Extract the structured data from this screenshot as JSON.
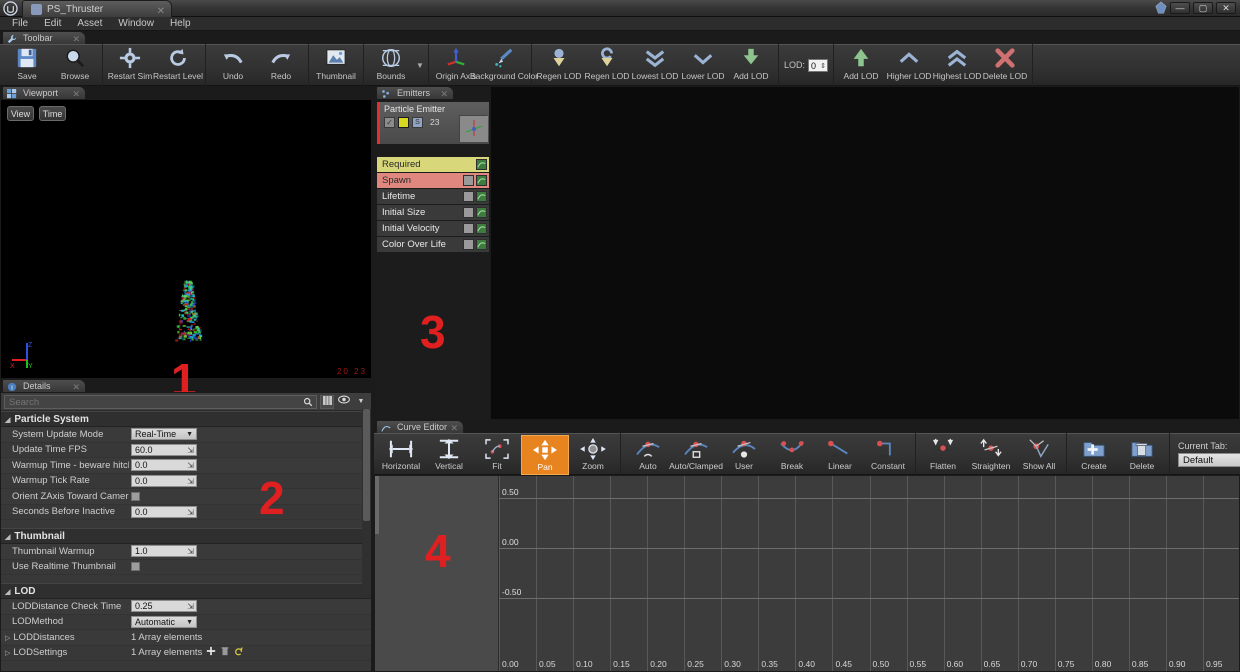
{
  "window": {
    "tab_title": "PS_Thruster",
    "logo_icon": "unreal-logo-icon",
    "minimize_label": "—",
    "maximize_label": "▢",
    "close_label": "✕"
  },
  "menu": {
    "items": [
      "File",
      "Edit",
      "Asset",
      "Window",
      "Help"
    ]
  },
  "toolbar": {
    "tab_label": "Toolbar",
    "groups": [
      {
        "buttons": [
          {
            "label": "Save",
            "icon": "save-disk-icon"
          },
          {
            "label": "Browse",
            "icon": "magnifier-icon"
          }
        ]
      },
      {
        "buttons": [
          {
            "label": "Restart Sim",
            "icon": "gear-icon"
          },
          {
            "label": "Restart Level",
            "icon": "refresh-circle-icon"
          }
        ]
      },
      {
        "buttons": [
          {
            "label": "Undo",
            "icon": "undo-arrow-icon"
          },
          {
            "label": "Redo",
            "icon": "redo-arrow-icon"
          }
        ]
      },
      {
        "buttons": [
          {
            "label": "Thumbnail",
            "icon": "thumbnail-icon"
          }
        ]
      },
      {
        "buttons": [
          {
            "label": "Bounds",
            "icon": "bounds-sphere-icon"
          }
        ],
        "has_caret": true
      },
      {
        "buttons": [
          {
            "label": "Origin Axis",
            "icon": "origin-axis-icon"
          },
          {
            "label": "Background Color",
            "icon": "paint-brush-icon"
          }
        ]
      },
      {
        "buttons": [
          {
            "label": "Regen LOD",
            "icon": "regen-lod-down-icon"
          },
          {
            "label": "Regen LOD",
            "icon": "regen-lod-dup-icon"
          },
          {
            "label": "Lowest LOD",
            "icon": "double-chevron-down-icon"
          },
          {
            "label": "Lower LOD",
            "icon": "chevron-down-icon"
          },
          {
            "label": "Add LOD",
            "icon": "plus-down-icon"
          }
        ]
      },
      {
        "buttons": [
          {
            "label": "Add LOD",
            "icon": "plus-up-icon"
          },
          {
            "label": "Higher LOD",
            "icon": "chevron-up-icon"
          },
          {
            "label": "Highest LOD",
            "icon": "double-chevron-up-icon"
          },
          {
            "label": "Delete LOD",
            "icon": "delete-x-icon"
          }
        ]
      }
    ],
    "lod_label": "LOD:",
    "lod_value": "0"
  },
  "viewport": {
    "tab_label": "Viewport",
    "tab_icon": "viewport-icon",
    "buttons": [
      "View",
      "Time"
    ],
    "region_marker": "1",
    "stats_text": "20  23",
    "axis_labels": [
      "X",
      "Y",
      "Z"
    ],
    "background_color": "#000000"
  },
  "details": {
    "tab_label": "Details",
    "tab_icon": "details-info-icon",
    "search_placeholder": "Search",
    "search_value": "",
    "region_marker": "2",
    "toolbar_icons": [
      "grid-view-icon",
      "eye-icon",
      "chevron-down-icon"
    ],
    "sections": [
      {
        "title": "Particle System",
        "rows": [
          {
            "name": "System Update Mode",
            "type": "select",
            "value": "Real-Time"
          },
          {
            "name": "Update Time FPS",
            "type": "number",
            "value": "60.0"
          },
          {
            "name": "Warmup Time - beware hitches!",
            "type": "number",
            "value": "0.0"
          },
          {
            "name": "Warmup Tick Rate",
            "type": "number",
            "value": "0.0"
          },
          {
            "name": "Orient ZAxis Toward Camera",
            "type": "checkbox",
            "value": ""
          },
          {
            "name": "Seconds Before Inactive",
            "type": "number",
            "value": "0.0"
          }
        ]
      },
      {
        "title": "Thumbnail",
        "rows": [
          {
            "name": "Thumbnail Warmup",
            "type": "number",
            "value": "1.0"
          },
          {
            "name": "Use Realtime Thumbnail",
            "type": "checkbox",
            "value": ""
          }
        ]
      },
      {
        "title": "LOD",
        "rows": [
          {
            "name": "LODDistance Check Time",
            "type": "number",
            "value": "0.25"
          },
          {
            "name": "LODMethod",
            "type": "select",
            "value": "Automatic"
          },
          {
            "name": "LODDistances",
            "type": "array",
            "value": "1 Array elements",
            "expandable": true
          },
          {
            "name": "LODSettings",
            "type": "array-actions",
            "value": "1 Array elements",
            "expandable": true,
            "actions": [
              "add-icon",
              "delete-icon",
              "reset-icon"
            ]
          }
        ]
      }
    ]
  },
  "emitters": {
    "tab_label": "Emitters",
    "tab_icon": "emitters-icon",
    "region_marker": "3",
    "emitter": {
      "name": "Particle Emitter",
      "count": "23",
      "checkboxes": [
        "enabled-checkbox",
        "solo-checkbox",
        "render-checkbox"
      ]
    },
    "modules": [
      {
        "label": "Required",
        "color": "#d8d87a",
        "text_color": "#2a2a2a",
        "has_enable_cb": false
      },
      {
        "label": "Spawn",
        "color": "#e08880",
        "text_color": "#2a2a2a",
        "has_enable_cb": true
      },
      {
        "label": "Lifetime",
        "color": "#3a3a3a",
        "text_color": "#e8e8e8",
        "has_enable_cb": true
      },
      {
        "label": "Initial Size",
        "color": "#3a3a3a",
        "text_color": "#e8e8e8",
        "has_enable_cb": true
      },
      {
        "label": "Initial Velocity",
        "color": "#3a3a3a",
        "text_color": "#e8e8e8",
        "has_enable_cb": true
      },
      {
        "label": "Color Over Life",
        "color": "#3a3a3a",
        "text_color": "#e8e8e8",
        "has_enable_cb": true
      }
    ]
  },
  "curve_editor": {
    "tab_label": "Curve Editor",
    "tab_icon": "curve-editor-icon",
    "region_marker": "4",
    "current_tab_label": "Current Tab:",
    "current_tab_value": "Default",
    "groups": [
      {
        "buttons": [
          {
            "label": "Horizontal",
            "icon": "fit-horizontal-icon",
            "active": false
          },
          {
            "label": "Vertical",
            "icon": "fit-vertical-icon",
            "active": false
          },
          {
            "label": "Fit",
            "icon": "fit-all-icon",
            "active": false
          },
          {
            "label": "Pan",
            "icon": "pan-icon",
            "active": true
          },
          {
            "label": "Zoom",
            "icon": "zoom-icon",
            "active": false
          }
        ]
      },
      {
        "buttons": [
          {
            "label": "Auto",
            "icon": "tangent-auto-icon",
            "active": false
          },
          {
            "label": "Auto/Clamped",
            "icon": "tangent-clamped-icon",
            "active": false
          },
          {
            "label": "User",
            "icon": "tangent-user-icon",
            "active": false
          },
          {
            "label": "Break",
            "icon": "tangent-break-icon",
            "active": false
          },
          {
            "label": "Linear",
            "icon": "tangent-linear-icon",
            "active": false
          },
          {
            "label": "Constant",
            "icon": "tangent-constant-icon",
            "active": false
          }
        ]
      },
      {
        "buttons": [
          {
            "label": "Flatten",
            "icon": "flatten-icon",
            "active": false
          },
          {
            "label": "Straighten",
            "icon": "straighten-icon",
            "active": false
          },
          {
            "label": "Show All",
            "icon": "show-all-icon",
            "active": false
          }
        ]
      },
      {
        "buttons": [
          {
            "label": "Create",
            "icon": "create-folder-icon",
            "active": false
          },
          {
            "label": "Delete",
            "icon": "delete-folder-icon",
            "active": false
          }
        ]
      }
    ]
  },
  "chart_data": {
    "type": "line",
    "title": "Curve Editor",
    "xlabel": "",
    "ylabel": "",
    "xlim": [
      0.0,
      0.97
    ],
    "ylim": [
      -0.85,
      0.72
    ],
    "x_ticks": [
      "0.00",
      "0.05",
      "0.10",
      "0.15",
      "0.20",
      "0.25",
      "0.30",
      "0.35",
      "0.40",
      "0.45",
      "0.50",
      "0.55",
      "0.60",
      "0.65",
      "0.70",
      "0.75",
      "0.80",
      "0.85",
      "0.90",
      "0.95"
    ],
    "y_ticks": [
      "0.50",
      "0.00",
      "-0.50"
    ],
    "grid": true,
    "legend": "none",
    "series": []
  }
}
